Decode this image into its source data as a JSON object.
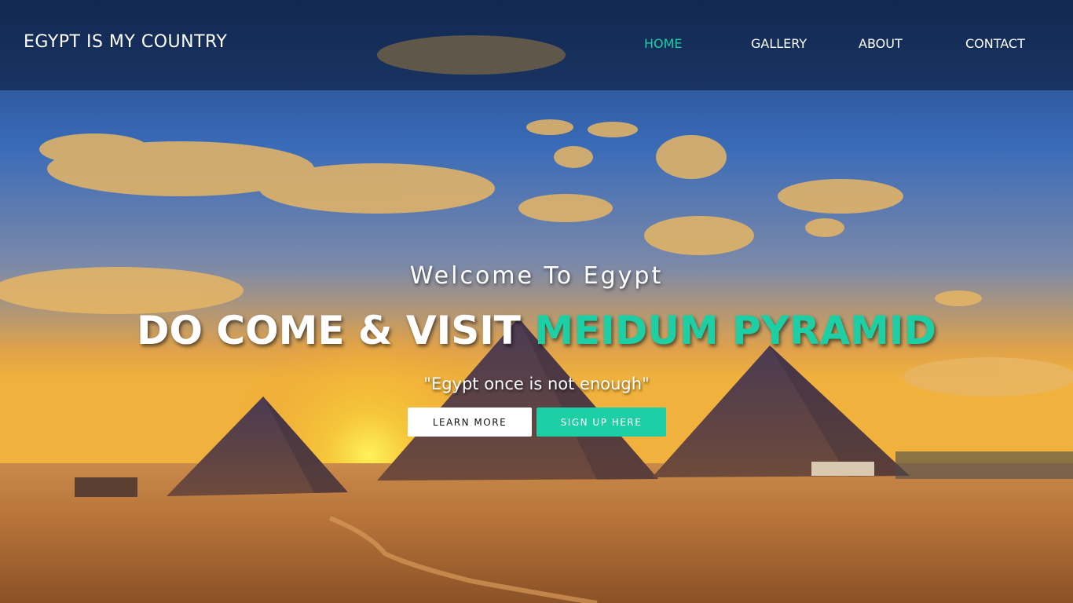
{
  "navbar": {
    "brand": "EGYPT IS MY COUNTRY",
    "links": [
      {
        "label": "HOME",
        "active": true
      },
      {
        "label": "GALLERY",
        "active": false
      },
      {
        "label": "ABOUT",
        "active": false
      },
      {
        "label": "CONTACT",
        "active": false
      }
    ]
  },
  "hero": {
    "welcome": "Welcome To Egypt",
    "headline_main": "DO COME & VISIT",
    "headline_accent": "MEIDUM PYRAMID",
    "quote": "\"Egypt once is not enough\"",
    "buttons": {
      "learn_more": "LEARN MORE",
      "sign_up": "SIGN UP HERE"
    }
  },
  "colors": {
    "accent": "#1ccfa5",
    "navbar_bg": "#08162f"
  },
  "background_image": "pyramids-desert-sunset-photo"
}
